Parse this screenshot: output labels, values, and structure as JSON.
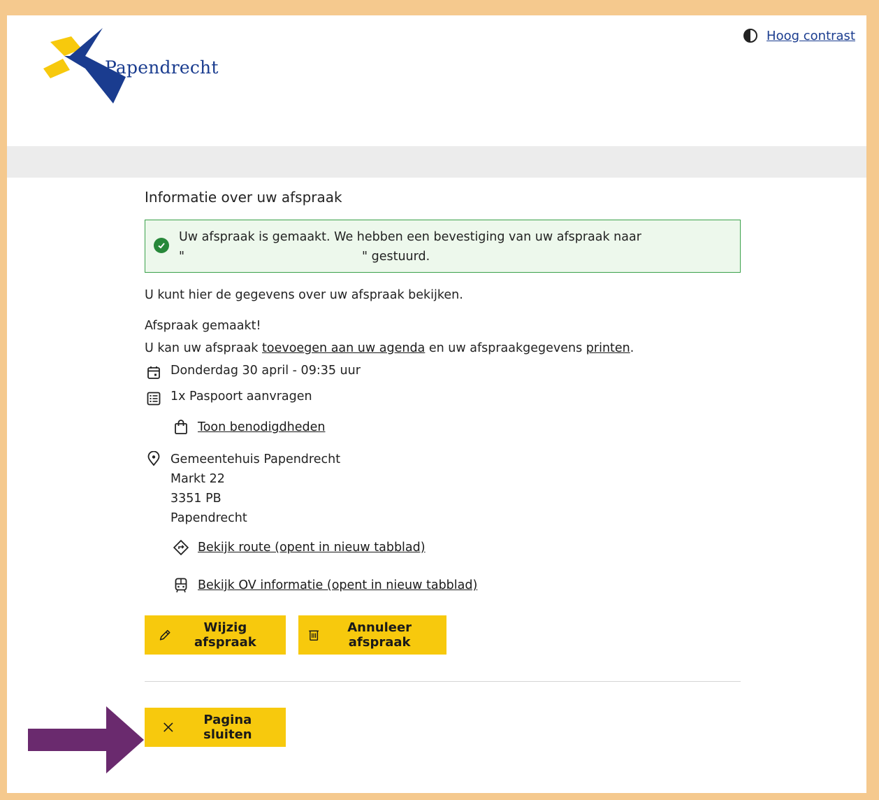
{
  "header": {
    "logo_text": "Papendrecht",
    "contrast_label": "Hoog contrast"
  },
  "main": {
    "heading": "Informatie over uw afspraak",
    "success": {
      "line1": "Uw afspraak is gemaakt. We hebben een bevestiging van uw afspraak naar",
      "open_quote": "\"",
      "line2_rest": "\" gestuurd."
    },
    "intro": "U kunt hier de gegevens over uw afspraak bekijken.",
    "made": "Afspraak gemaakt!",
    "add": {
      "prefix": "U kan uw afspraak ",
      "agenda_link": "toevoegen aan uw agenda",
      "middle": " en uw afspraakgegevens ",
      "print_link": "printen",
      "suffix": "."
    },
    "date": "Donderdag 30 april - 09:35 uur",
    "product": "1x Paspoort aanvragen",
    "requirements_link": "Toon benodigdheden",
    "location": {
      "name": "Gemeentehuis Papendrecht",
      "street": "Markt 22",
      "postcode": "3351 PB",
      "city": "Papendrecht"
    },
    "route_link": "Bekijk route (opent in nieuw tabblad)",
    "ov_link": "Bekijk OV informatie (opent in nieuw tabblad)",
    "buttons": {
      "edit": "Wijzig afspraak",
      "cancel": "Annuleer afspraak",
      "close": "Pagina sluiten"
    }
  },
  "colors": {
    "frame": "#f5c98e",
    "accent_button": "#f7c90d",
    "success_border": "#3aa14a",
    "logo_blue": "#1a3c8f",
    "logo_yellow": "#f7c90d",
    "arrow": "#6a2a6e"
  },
  "icons": [
    "contrast-icon",
    "check-circle-icon",
    "calendar-icon",
    "list-icon",
    "bag-icon",
    "location-pin-icon",
    "route-icon",
    "bus-icon",
    "pencil-icon",
    "trash-icon",
    "close-icon",
    "arrow-right-icon"
  ]
}
